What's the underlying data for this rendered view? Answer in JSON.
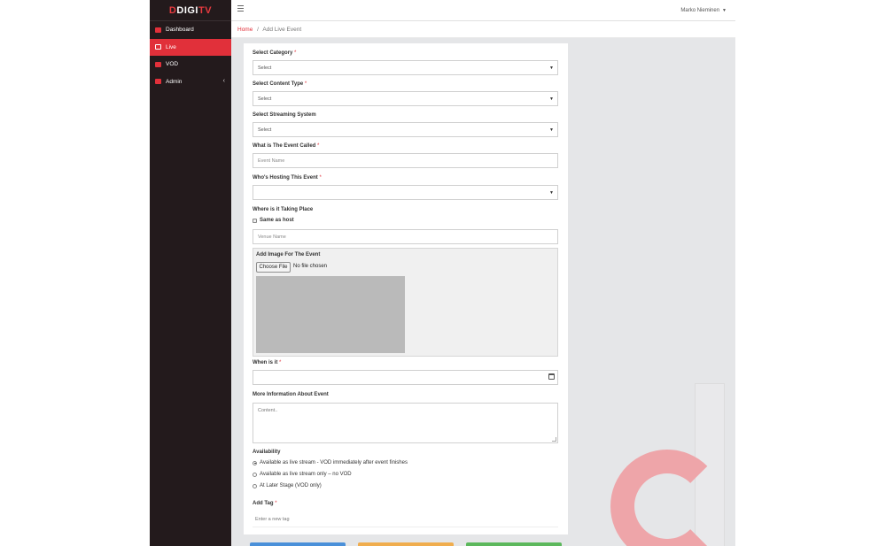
{
  "brand": {
    "prefix": "D",
    "name": "DIGI",
    "suffix": "TV"
  },
  "sidebar": {
    "items": [
      {
        "label": "Dashboard",
        "icon": "dashboard-icon",
        "active": false
      },
      {
        "label": "Live",
        "icon": "tv-icon",
        "active": true
      },
      {
        "label": "VOD",
        "icon": "vod-icon",
        "active": false
      },
      {
        "label": "Admin",
        "icon": "admin-icon",
        "active": false,
        "chevron": "‹"
      }
    ]
  },
  "header": {
    "user_name": "Marko Nieminen",
    "user_caret": "▼"
  },
  "breadcrumb": {
    "home": "Home",
    "separator": "/",
    "current": "Add Live Event"
  },
  "form": {
    "category": {
      "label": "Select Category",
      "required": "*",
      "value": "Select"
    },
    "content_type": {
      "label": "Select Content Type",
      "required": "*",
      "value": "Select"
    },
    "streaming": {
      "label": "Select Streaming System",
      "value": "Select"
    },
    "event_name": {
      "label": "What is The Event Called",
      "required": "*",
      "placeholder": "Event Name"
    },
    "host": {
      "label": "Who's Hosting This Event",
      "required": "*",
      "value": ""
    },
    "place": {
      "label": "Where is it Taking Place",
      "same_as_host": "Same as host",
      "venue_placeholder": "Venue Name"
    },
    "image": {
      "label": "Add Image For The Event",
      "choose_btn": "Choose File",
      "no_file": "No file chosen"
    },
    "when": {
      "label": "When is it",
      "required": "*",
      "value": ""
    },
    "more_info": {
      "label": "More Information About Event",
      "placeholder": "Content.."
    },
    "availability": {
      "label": "Availability",
      "options": [
        {
          "label": "Available as live stream - VOD immediately after event finishes",
          "checked": true
        },
        {
          "label": "Available as live stream only – no VOD",
          "checked": false
        },
        {
          "label": "At Later Stage (VOD only)",
          "checked": false
        }
      ]
    },
    "tag": {
      "label": "Add Tag",
      "required": "*",
      "placeholder": "Enter a new tag"
    }
  },
  "colors": {
    "accent": "#e1303a",
    "sidebar_bg": "#231a1c",
    "btn_blue": "#4a90d9",
    "btn_orange": "#f0ad4e",
    "btn_green": "#5cb85c"
  }
}
